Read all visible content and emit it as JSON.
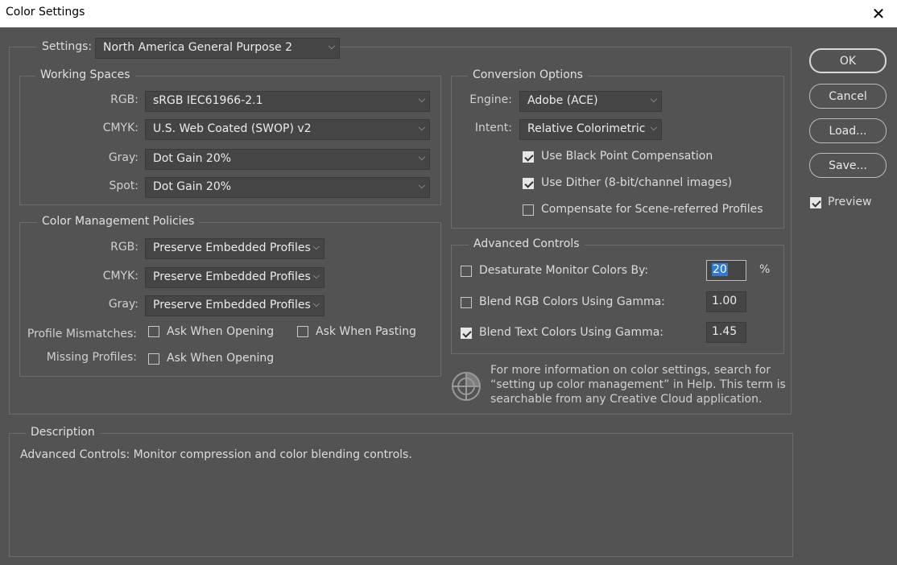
{
  "window": {
    "title": "Color Settings",
    "close_glyph": "✕"
  },
  "settings": {
    "label": "Settings:",
    "value": "North America General Purpose 2"
  },
  "working_spaces": {
    "legend": "Working Spaces",
    "rgb": {
      "label": "RGB:",
      "value": "sRGB IEC61966-2.1"
    },
    "cmyk": {
      "label": "CMYK:",
      "value": "U.S. Web Coated (SWOP) v2"
    },
    "gray": {
      "label": "Gray:",
      "value": "Dot Gain 20%"
    },
    "spot": {
      "label": "Spot:",
      "value": "Dot Gain 20%"
    }
  },
  "policies": {
    "legend": "Color Management Policies",
    "rgb": {
      "label": "RGB:",
      "value": "Preserve Embedded Profiles"
    },
    "cmyk": {
      "label": "CMYK:",
      "value": "Preserve Embedded Profiles"
    },
    "gray": {
      "label": "Gray:",
      "value": "Preserve Embedded Profiles"
    },
    "profile_mismatches": {
      "label": "Profile Mismatches:",
      "ask_opening": "Ask When Opening",
      "ask_opening_checked": false,
      "ask_pasting": "Ask When Pasting",
      "ask_pasting_checked": false
    },
    "missing_profiles": {
      "label": "Missing Profiles:",
      "ask_opening": "Ask When Opening",
      "ask_opening_checked": false
    }
  },
  "conversion": {
    "legend": "Conversion Options",
    "engine": {
      "label": "Engine:",
      "value": "Adobe (ACE)"
    },
    "intent": {
      "label": "Intent:",
      "value": "Relative Colorimetric"
    },
    "black_point": {
      "label": "Use Black Point Compensation",
      "checked": true
    },
    "dither": {
      "label": "Use Dither (8-bit/channel images)",
      "checked": true
    },
    "scene_referred": {
      "label": "Compensate for Scene-referred Profiles",
      "checked": false
    }
  },
  "advanced": {
    "legend": "Advanced Controls",
    "desaturate": {
      "label": "Desaturate Monitor Colors By:",
      "checked": false,
      "value": "20",
      "unit": "%"
    },
    "blend_rgb": {
      "label": "Blend RGB Colors Using Gamma:",
      "checked": false,
      "value": "1.00"
    },
    "blend_text": {
      "label": "Blend Text Colors Using Gamma:",
      "checked": true,
      "value": "1.45"
    }
  },
  "info": {
    "icon": "color-wheel-icon",
    "lines": [
      "For more information on color settings, search for",
      "“setting up color management” in Help. This term is",
      "searchable from any Creative Cloud application."
    ]
  },
  "description": {
    "legend": "Description",
    "text": "Advanced Controls:  Monitor compression and color blending controls."
  },
  "buttons": {
    "ok": "OK",
    "cancel": "Cancel",
    "load": "Load...",
    "save": "Save..."
  },
  "preview": {
    "label": "Preview",
    "checked": true
  },
  "chevron_glyph": "⌵"
}
